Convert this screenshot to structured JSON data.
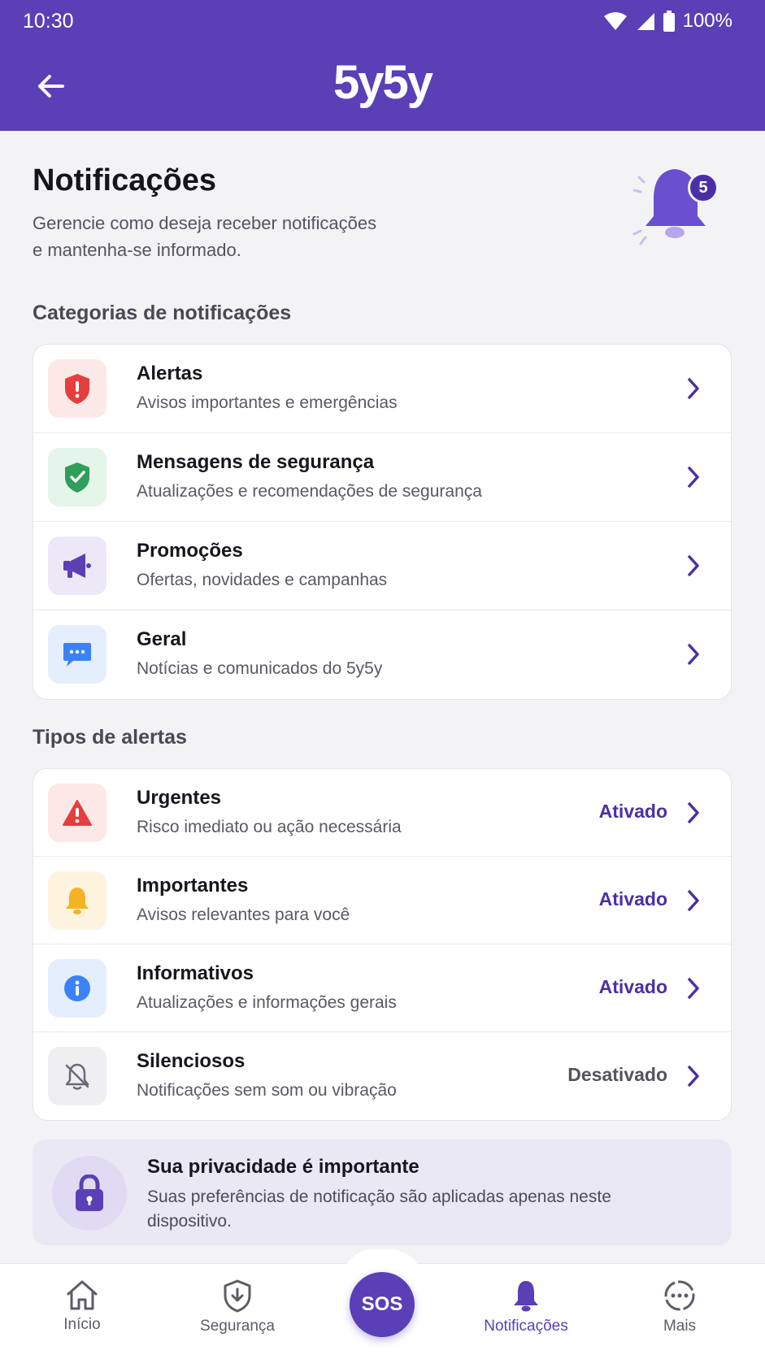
{
  "status_bar": {
    "time": "10:30",
    "battery": "100%"
  },
  "app": {
    "logo": "5y5y",
    "back_icon": "arrow-left-icon"
  },
  "header": {
    "title": "Notificações",
    "subtitle_line1": "Gerencie como deseja receber notificações",
    "subtitle_line2": "e mantenha-se informado.",
    "badge_count": "5"
  },
  "categories": {
    "section_title": "Categorias de notificações",
    "items": [
      {
        "title": "Alertas",
        "description": "Avisos importantes e emergências",
        "icon": "shield-alert-icon",
        "color": "#e53e3e",
        "bg": "#fde8e8"
      },
      {
        "title": "Mensagens de segurança",
        "description": "Atualizações e recomendações de segurança",
        "icon": "shield-check-icon",
        "color": "#2f9e58",
        "bg": "#e4f5ea"
      },
      {
        "title": "Promoções",
        "description": "Ofertas, novidades e campanhas",
        "icon": "megaphone-icon",
        "color": "#5a3fb6",
        "bg": "#ece8f8"
      },
      {
        "title": "Geral",
        "description": "Notícias e comunicados do 5y5y",
        "icon": "chat-bubble-icon",
        "color": "#3b82f6",
        "bg": "#e5eefc"
      }
    ]
  },
  "alert_types": {
    "section_title": "Tipos de alertas",
    "items": [
      {
        "title": "Urgentes",
        "description": "Risco imediato ou ação necessária",
        "status": "Ativado",
        "icon": "warning-triangle-icon",
        "color": "#e53e3e",
        "bg": "#fde8e8"
      },
      {
        "title": "Importantes",
        "description": "Avisos relevantes para você",
        "status": "Ativado",
        "icon": "bell-icon",
        "color": "#f5b324",
        "bg": "#fdf3df"
      },
      {
        "title": "Informativos",
        "description": "Atualizações e informações gerais",
        "status": "Ativado",
        "icon": "info-icon",
        "color": "#3b82f6",
        "bg": "#e5eefc"
      },
      {
        "title": "Silenciosos",
        "description": "Notificações sem som ou vibração",
        "status": "Desativado",
        "icon": "bell-off-icon",
        "color": "#6b6975",
        "bg": "#efeff2"
      }
    ],
    "status_colors": {
      "on": "#4b2fa6",
      "off": "#55535e"
    }
  },
  "privacy": {
    "title": "Sua privacidade é importante",
    "text": "Suas preferências de notificação são aplicadas apenas neste dispositivo."
  },
  "bottom_nav": {
    "items": [
      {
        "label": "Início",
        "icon": "home-icon"
      },
      {
        "label": "Segurança",
        "icon": "shield-download-icon"
      },
      {
        "label": "Notificações",
        "icon": "bell-icon",
        "active": true
      },
      {
        "label": "Mais",
        "icon": "more-circle-icon"
      }
    ],
    "sos_label": "SOS"
  },
  "colors": {
    "brand": "#5a3fb6",
    "background": "#f3f3f6"
  }
}
